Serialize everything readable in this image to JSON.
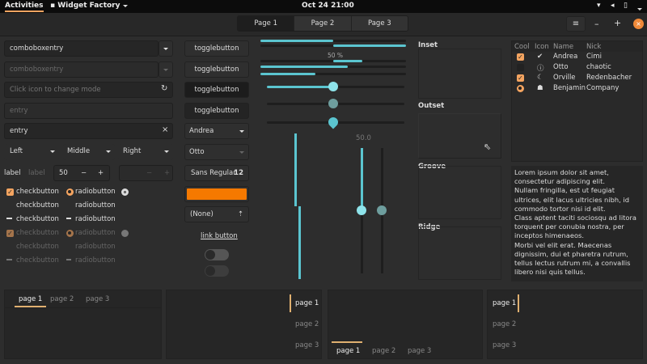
{
  "topbar": {
    "activities": "Activities",
    "app": "Widget Factory",
    "clock": "Oct 24  21:00"
  },
  "header": {
    "pages": [
      "Page 1",
      "Page 2",
      "Page 3"
    ],
    "active_page": 0
  },
  "left": {
    "combo1": "comboboxentry",
    "combo2": "comboboxentry",
    "entry_mode_placeholder": "Click icon to change mode",
    "entry_disabled": "entry",
    "entry": "entry",
    "combos": [
      "Left",
      "Middle",
      "Right"
    ],
    "label1": "label",
    "label2": "label",
    "spin_value": "50",
    "checks": [
      "checkbutton",
      "checkbutton",
      "checkbutton",
      "checkbutton",
      "checkbutton",
      "checkbutton"
    ],
    "radios": [
      "radiobutton",
      "radiobutton",
      "radiobutton",
      "radiobutton",
      "radiobutton",
      "radiobutton"
    ]
  },
  "middle": {
    "toggles": [
      "togglebutton",
      "togglebutton",
      "togglebutton",
      "togglebutton"
    ],
    "combo_andrea": "Andrea",
    "combo_otto": "Otto",
    "font_name": "Sans Regular",
    "font_size": "12",
    "color": "#f57900",
    "file": "(None)",
    "link": "link button"
  },
  "scales": {
    "progress_label": "50 %",
    "scale_value": "50.0",
    "value": 50
  },
  "frames": [
    "Inset",
    "Outset",
    "Groove",
    "Ridge"
  ],
  "tree": {
    "columns": [
      "Cool",
      "Icon",
      "Name",
      "Nick"
    ],
    "rows": [
      {
        "cool": "check",
        "icon": "check-circle-icon",
        "name": "Andrea",
        "nick": "Cimi"
      },
      {
        "cool": "none",
        "icon": "info-icon",
        "name": "Otto",
        "nick": "chaotic"
      },
      {
        "cool": "check",
        "icon": "moon-icon",
        "name": "Orville",
        "nick": "Redenbacher"
      },
      {
        "cool": "radio",
        "icon": "robot-icon",
        "name": "Benjamin",
        "nick": "Company"
      }
    ]
  },
  "textview": "Lorem ipsum dolor sit amet, consectetur adipiscing elit.\nNullam fringilla, est ut feugiat ultrices, elit lacus ultricies nibh, id commodo tortor nisi id elit.\nClass aptent taciti sociosqu ad litora torquent per conubia nostra, per inceptos himenaeos.\nMorbi vel elit erat. Maecenas dignissim, dui et pharetra rutrum, tellus lectus rutrum mi, a convallis libero nisi quis tellus.",
  "notebook_tabs": [
    "page 1",
    "page 2",
    "page 3"
  ],
  "colors": {
    "accent": "#f4a460",
    "slider": "#5bc5d0",
    "close": "#f08a3a"
  }
}
